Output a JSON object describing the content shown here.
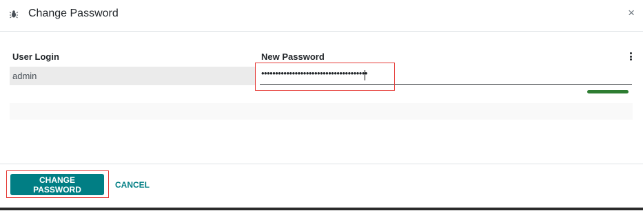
{
  "dialog": {
    "title": "Change Password",
    "icon": "bug-icon",
    "close_glyph": "×"
  },
  "table": {
    "columns": [
      "User Login",
      "New Password"
    ],
    "rows": [
      {
        "user_login": "admin",
        "new_password": "••••••••••••••••••••••••••••••••••••••"
      }
    ],
    "password_strength": 1.0
  },
  "footer": {
    "primary_label": "CHANGE PASSWORD",
    "cancel_label": "CANCEL"
  },
  "colors": {
    "accent": "#017e84",
    "strength": "#2e7d32",
    "highlight": "#e53935"
  }
}
